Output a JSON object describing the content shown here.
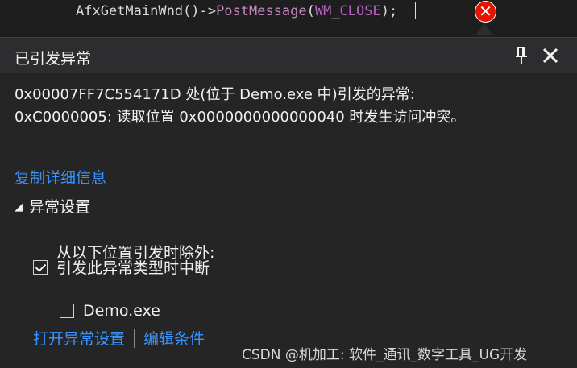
{
  "editor": {
    "code_prefix": "AfxGetMainWnd()->",
    "code_method": "PostMessage",
    "code_paren_open": "(",
    "code_macro": "WM_CLOSE",
    "code_suffix": ");"
  },
  "popup": {
    "title": "已引发异常",
    "message_line1": "0x00007FF7C554171D 处(位于 Demo.exe 中)引发的异常:",
    "message_line2": "0xC0000005: 读取位置 0x0000000000000040 时发生访问冲突。",
    "copy_details": "复制详细信息",
    "exception_settings": "异常设置",
    "break_when_thrown": "引发此异常类型时中断",
    "except_when_thrown_from": "从以下位置引发时除外:",
    "module_name": "Demo.exe",
    "open_settings": "打开异常设置",
    "edit_conditions": "编辑条件"
  },
  "state": {
    "break_checked": true,
    "module_checked": false
  },
  "watermark": "CSDN @机加工: 软件_通讯_数字工具_UG开发",
  "colors": {
    "background": "#1e1e1e",
    "popup": "#252526",
    "link": "#3794ff",
    "error": "#e51400"
  },
  "icons": [
    "error-icon",
    "pin-icon",
    "close-icon",
    "collapse-triangle-icon",
    "checkbox-icon"
  ]
}
